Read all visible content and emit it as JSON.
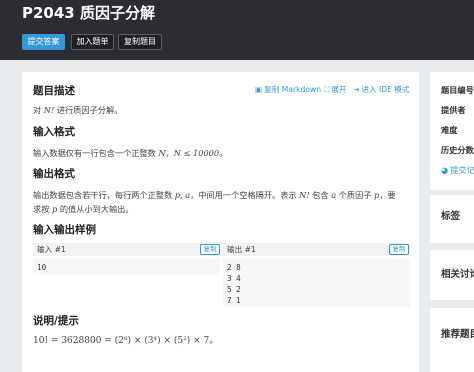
{
  "header": {
    "title": "P2043 质因子分解",
    "buttons": {
      "submit": "提交答案",
      "add_to_list": "加入题单",
      "copy_problem": "复制题目"
    }
  },
  "toolbar": {
    "copy_markdown": "复制 Markdown",
    "expand": "展开",
    "enter_ide": "进入 IDE 模式"
  },
  "problem": {
    "description_heading": "题目描述",
    "description": {
      "pre": "对 ",
      "math": "N!",
      "post": " 进行质因子分解。"
    },
    "input_heading": "输入格式",
    "input": {
      "pre": "输入数据仅有一行包含一个正整数 ",
      "math1": "N",
      "mid": "，",
      "math2": "N ≤ 10000",
      "post": "。"
    },
    "output_heading": "输出格式",
    "output": {
      "line1_pre": "输出数据包含若干行，每行两个正整数 ",
      "line1_math1": "p, a",
      "line1_mid": "，中间用一个空格隔开。表示 ",
      "line1_math2": "N!",
      "line1_mid2": " 包含 ",
      "line1_math3": "a",
      "line1_post": " 个质因子 ",
      "line1_math4": "p",
      "line1_end": "，要",
      "line2_pre": "求按 ",
      "line2_math": "p",
      "line2_post": " 的值从小到大输出。"
    },
    "samples_heading": "输入输出样例",
    "sample_input_label": "输入 #1",
    "sample_output_label": "输出 #1",
    "copy_label": "复制",
    "sample_input": "10",
    "sample_output": "2 8\n3 4\n5 2\n7 1",
    "notes_heading": "说明/提示",
    "notes_formula": "10! = 3628800 = (2⁸) × (3⁴) × (5²) × 7。"
  },
  "sidebar": {
    "info": [
      "题目编号",
      "提供者",
      "难度",
      "历史分数"
    ],
    "submit_link": "提交记",
    "tags": "标签",
    "related": "相关讨论",
    "recommended": "推荐题目"
  }
}
